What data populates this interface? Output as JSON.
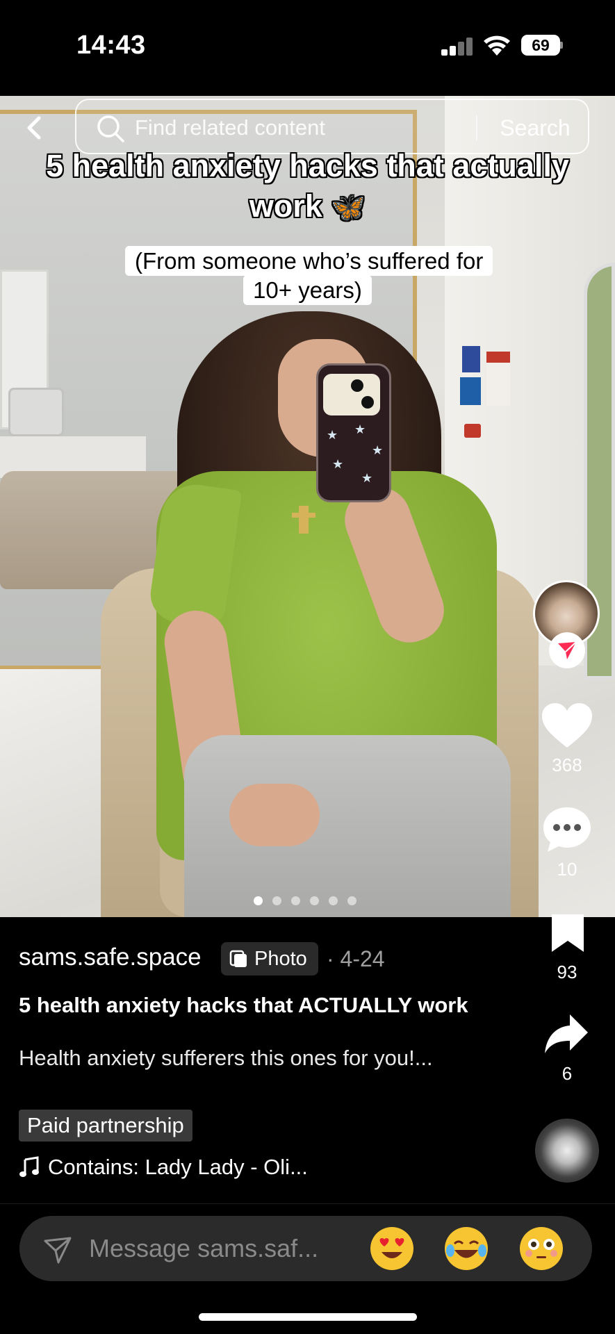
{
  "status_bar": {
    "time": "14:43",
    "battery": "69"
  },
  "search": {
    "placeholder": "Find related content",
    "button_label": "Search"
  },
  "post_overlay": {
    "title": "5 health anxiety hacks that actually work",
    "title_emoji": "🦋",
    "subtitle": "(From someone who’s suffered for 10+ years)"
  },
  "carousel": {
    "total_slides": 6,
    "active_slide": 1
  },
  "actions": {
    "likes": "368",
    "comments": "10",
    "saves": "93",
    "shares": "6"
  },
  "caption": {
    "username": "sams.safe.space",
    "badge": "Photo",
    "date": "· 4-24",
    "title": "5 health anxiety hacks that ACTUALLY work",
    "description": "Health anxiety sufferers this ones for you!...",
    "paid_label": "Paid partnership",
    "music": "Contains: Lady Lady - Oli..."
  },
  "message_bar": {
    "placeholder": "Message sams.saf...",
    "emojis": [
      "heart-eyes",
      "tears-of-joy",
      "flushed"
    ]
  },
  "colors": {
    "background": "#000000",
    "follow_badge_accent": "#fe2c55",
    "shirt_green": "#8fb43c"
  }
}
